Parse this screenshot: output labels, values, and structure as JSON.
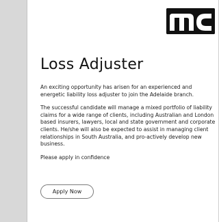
{
  "page": {
    "title": "Loss Adjuster",
    "paragraphs": [
      "An exciting opportunity has arisen for an experienced and energetic liability loss adjuster to join the Adelaide branch.",
      "The successful candidate will manage a mixed portfolio of liability claims for a wide range of clients, including Australian and London based insurers, lawyers, local and state government and corporate clients. He/she will also be expected to assist in managing client relationships in South Australia, and pro-actively develop new business.",
      "Please apply in confidence"
    ],
    "apply_button_label": "Apply Now"
  },
  "logo": {
    "text": "mc",
    "background": "#111111",
    "foreground": "#ffffff"
  },
  "colors": {
    "sidebar": "#d8d8d8",
    "text": "#1a1a1a",
    "button_border": "#7a7a7a"
  }
}
